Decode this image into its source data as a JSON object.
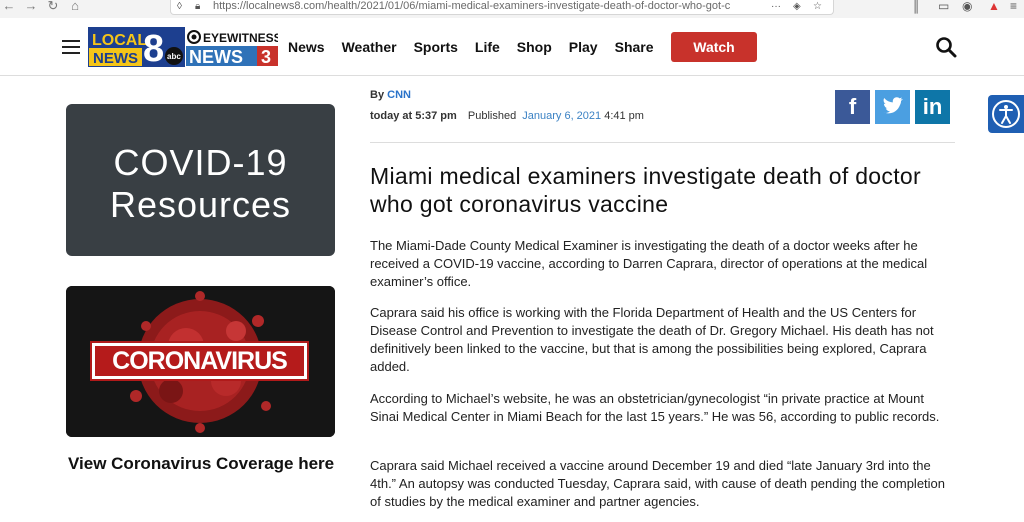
{
  "browser": {
    "url": "https://localnews8.com/health/2021/01/06/miami-medical-examiners-investigate-death-of-doctor-who-got-c",
    "more_label": "···"
  },
  "header": {
    "logo_left": {
      "line1": "LOCAL",
      "line2": "NEWS",
      "numeral": "8",
      "network": "abc"
    },
    "logo_right": {
      "line1": "EYEWITNESS",
      "line2": "NEWS",
      "numeral": "3"
    },
    "nav": [
      "News",
      "Weather",
      "Sports",
      "Life",
      "Shop",
      "Play",
      "Share"
    ],
    "watch_label": "Watch"
  },
  "sidebar": {
    "covid_line1": "COVID-19",
    "covid_line2": "Resources",
    "banner_text": "CORONAVIRUS",
    "coverage_link": "View Coronavirus Coverage here"
  },
  "article": {
    "by_prefix": "By",
    "source": "CNN",
    "time": "today at 5:37 pm",
    "published_label": "Published",
    "published_date": "January 6, 2021",
    "published_time": "4:41 pm",
    "headline": "Miami medical examiners investigate death of doctor who got coronavirus vaccine",
    "paragraphs": [
      "The Miami-Dade County Medical Examiner is investigating the death of a doctor weeks after he received a COVID-19 vaccine, according to Darren Caprara, director of operations at the medical examiner’s office.",
      "Caprara said his office is working with the Florida Department of Health and the US Centers for Disease Control and Prevention to investigate the death of Dr. Gregory Michael. His death has not definitively been linked to the vaccine, but that is among the possibilities being explored, Caprara added.",
      "According to Michael’s website, he was an obstetrician/gynecologist “in private practice at Mount Sinai Medical Center in Miami Beach for the last 15 years.” He was 56, according to public records.",
      "Caprara said Michael received a vaccine around December 19 and died “late January 3rd into the 4th.” An autopsy was conducted Tuesday, Caprara said, with cause of death pending the completion of studies by the medical examiner and partner agencies."
    ]
  },
  "social": {
    "facebook": "f",
    "twitter": "twitter-icon",
    "linkedin": "in"
  },
  "colors": {
    "watch": "#c8322b",
    "facebook": "#3b5998",
    "twitter": "#4b9fe1",
    "linkedin": "#0e76a8",
    "accessibility": "#1f5fb3"
  }
}
